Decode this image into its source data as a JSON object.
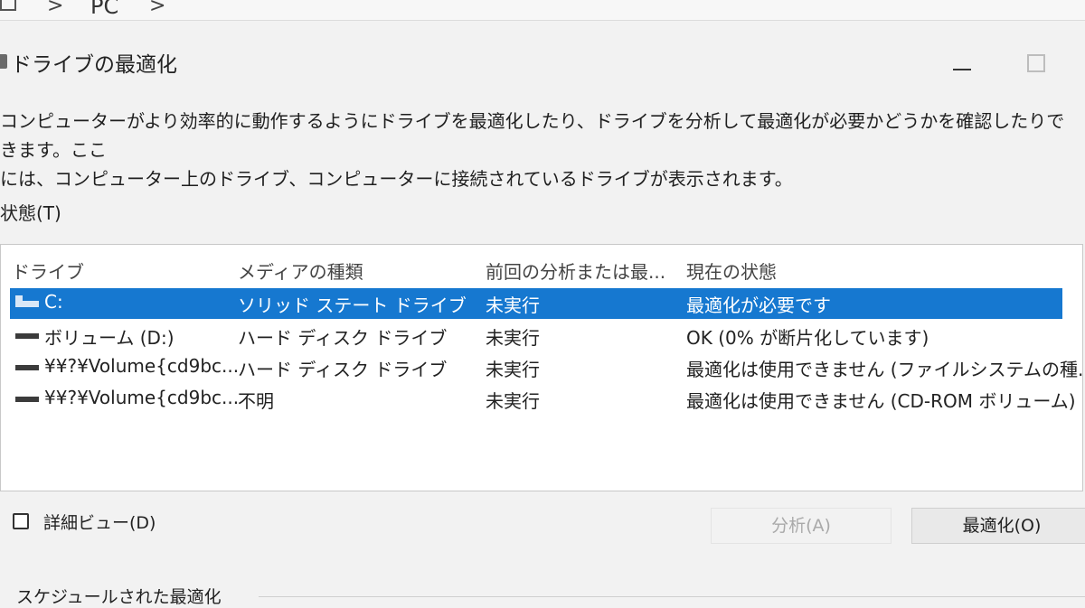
{
  "breadcrumb": {
    "location": "PC",
    "separator": ">"
  },
  "window": {
    "title": "ドライブの最適化",
    "icon": "defrag-icon"
  },
  "description": {
    "line1": "コンピューターがより効率的に動作するようにドライブを最適化したり、ドライブを分析して最適化が必要かどうかを確認したりできます。ここ",
    "line2": "には、コンピューター上のドライブ、コンピューターに接続されているドライブが表示されます。"
  },
  "status_section": {
    "label": "状態(T)"
  },
  "table": {
    "columns": [
      "ドライブ",
      "メディアの種類",
      "前回の分析または最...",
      "現在の状態"
    ],
    "rows": [
      {
        "drive": "C:",
        "media": "ソリッド ステート ドライブ",
        "last": "未実行",
        "status": "最適化が必要です",
        "selected": true,
        "icon": "system-drive-icon"
      },
      {
        "drive": "ボリューム (D:)",
        "media": "ハード ディスク ドライブ",
        "last": "未実行",
        "status": "OK (0% が断片化しています)",
        "selected": false,
        "icon": "drive-icon"
      },
      {
        "drive": "¥¥?¥Volume{cd9bc...",
        "media": "ハード ディスク ドライブ",
        "last": "未実行",
        "status": "最適化は使用できません (ファイルシステムの種...",
        "selected": false,
        "icon": "drive-icon"
      },
      {
        "drive": "¥¥?¥Volume{cd9bc...",
        "media": "不明",
        "last": "未実行",
        "status": "最適化は使用できません (CD-ROM ボリューム)",
        "selected": false,
        "icon": "drive-icon"
      }
    ]
  },
  "detail_view": {
    "label": "詳細ビュー(D)",
    "checked": false
  },
  "buttons": {
    "analyze": "分析(A)",
    "optimize": "最適化(O)"
  },
  "schedule_section": {
    "label": "スケジュールされた最適化"
  },
  "colors": {
    "selection": "#1678d0",
    "background": "#f2f2f2",
    "list_background": "#ffffff"
  }
}
